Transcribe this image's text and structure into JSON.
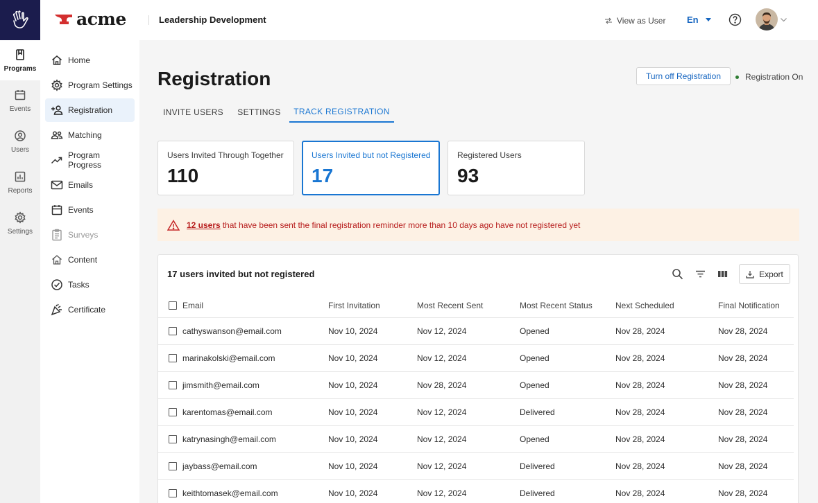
{
  "rail": {
    "items": [
      {
        "label": "Programs",
        "icon": "book-icon"
      },
      {
        "label": "Events",
        "icon": "calendar-icon"
      },
      {
        "label": "Users",
        "icon": "user-circle-icon"
      },
      {
        "label": "Reports",
        "icon": "bar-chart-icon"
      },
      {
        "label": "Settings",
        "icon": "gear-icon"
      }
    ]
  },
  "header": {
    "brand": "acme",
    "title": "Leadership Development",
    "view_as": "View as User",
    "language": "En"
  },
  "nav": {
    "items": [
      {
        "label": "Home",
        "icon": "home-icon"
      },
      {
        "label": "Program Settings",
        "icon": "gear-icon"
      },
      {
        "label": "Registration",
        "icon": "add-user-icon"
      },
      {
        "label": "Matching",
        "icon": "users-icon"
      },
      {
        "label": "Program Progress",
        "icon": "trending-up-icon"
      },
      {
        "label": "Emails",
        "icon": "mail-icon"
      },
      {
        "label": "Events",
        "icon": "calendar-icon"
      },
      {
        "label": "Surveys",
        "icon": "clipboard-icon"
      },
      {
        "label": "Content",
        "icon": "home-icon"
      },
      {
        "label": "Tasks",
        "icon": "check-circle-icon"
      },
      {
        "label": "Certificate",
        "icon": "party-icon"
      }
    ]
  },
  "main": {
    "title": "Registration",
    "toggle_button": "Turn off Registration",
    "status": "Registration On",
    "tabs": [
      "INVITE USERS",
      "SETTINGS",
      "TRACK REGISTRATION"
    ],
    "stats": [
      {
        "label": "Users Invited Through Together",
        "value": "110"
      },
      {
        "label": "Users Invited but not Registered",
        "value": "17"
      },
      {
        "label": "Registered Users",
        "value": "93"
      }
    ],
    "alert": {
      "link": "12 users",
      "text": "that have been sent the final registration reminder more than 10 days ago have not registered yet"
    }
  },
  "table": {
    "title": "17 users invited but not registered",
    "export_label": "Export",
    "columns": [
      "Email",
      "First Invitation",
      "Most Recent Sent",
      "Most Recent Status",
      "Next Scheduled",
      "Final Notification"
    ],
    "rows": [
      [
        "cathyswanson@email.com",
        "Nov 10, 2024",
        "Nov 12, 2024",
        "Opened",
        "Nov 28, 2024",
        "Nov 28, 2024"
      ],
      [
        "marinakolski@email.com",
        "Nov 10, 2024",
        "Nov 12, 2024",
        "Opened",
        "Nov 28, 2024",
        "Nov 28, 2024"
      ],
      [
        "jimsmith@email.com",
        "Nov 10, 2024",
        "Nov 28, 2024",
        "Opened",
        "Nov 28, 2024",
        "Nov 28, 2024"
      ],
      [
        "karentomas@email.com",
        "Nov 10, 2024",
        "Nov 12, 2024",
        "Delivered",
        "Nov 28, 2024",
        "Nov 28, 2024"
      ],
      [
        "katrynasingh@email.com",
        "Nov 10, 2024",
        "Nov 12, 2024",
        "Opened",
        "Nov 28, 2024",
        "Nov 28, 2024"
      ],
      [
        "jaybass@email.com",
        "Nov 10, 2024",
        "Nov 12, 2024",
        "Delivered",
        "Nov 28, 2024",
        "Nov 28, 2024"
      ],
      [
        "keithtomasek@email.com",
        "Nov 10, 2024",
        "Nov 12, 2024",
        "Delivered",
        "Nov 28, 2024",
        "Nov 28, 2024"
      ]
    ]
  },
  "colors": {
    "accent": "#1976d2",
    "rail_logo_bg": "#1b1c4d",
    "brand_red": "#d32f2f",
    "alert_bg": "#fdf1e4",
    "alert_text": "#b71c1c",
    "status_green": "#2e7d32"
  }
}
